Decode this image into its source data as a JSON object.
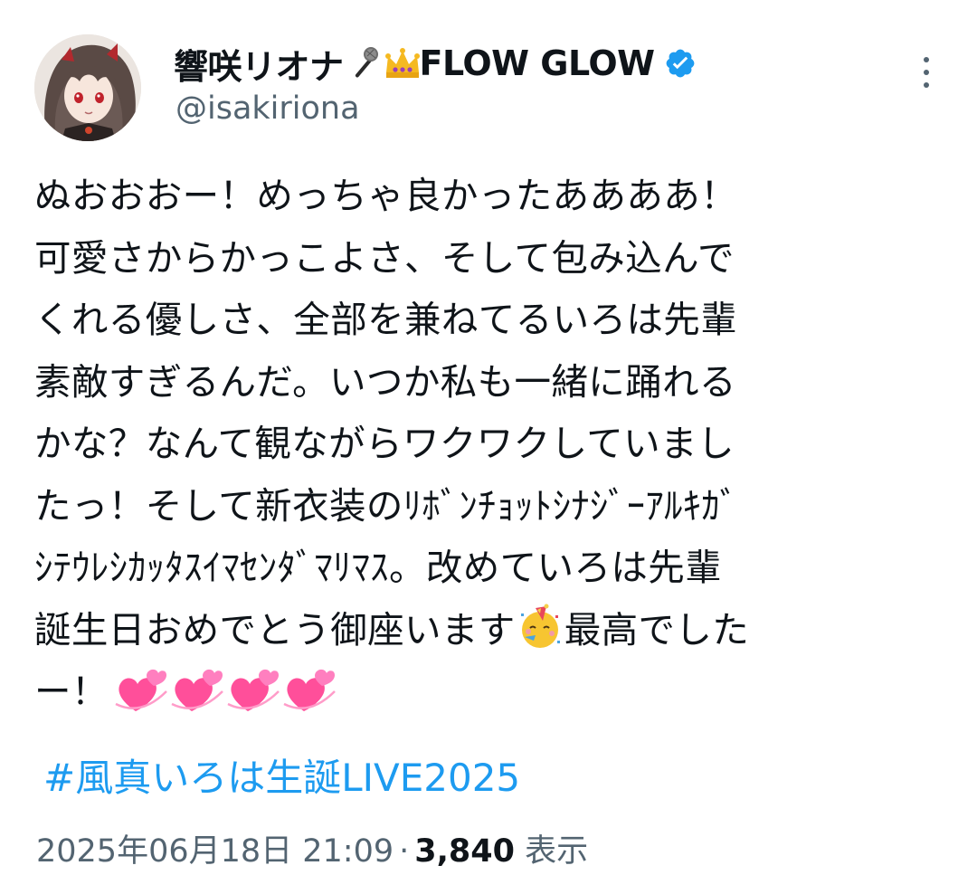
{
  "post": {
    "author": {
      "display_name": "響咲リオナ",
      "display_name_suffix": "FLOW GLOW",
      "name_emojis": [
        "microphone-emoji",
        "crown-emoji"
      ],
      "handle": "@isakiriona",
      "verified": true
    },
    "text_lines": [
      "ぬおおおー！めっちゃ良かったああああ！",
      "可愛さからかっこよさ、そして包み込んで",
      "くれる優しさ、全部を兼ねてるいろは先輩",
      "素敵すぎるんだ。いつか私も一緒に踊れる",
      "かな？なんて観ながらワクワクしていまし",
      "たっ！そして新衣装のﾘﾎﾞﾝﾁｮｯﾄｼﾅｼﾞｰｱﾙｷｶﾞ",
      "ｼﾃｳﾚｼｶｯﾀｽｲﾏｾﾝﾀﾞﾏﾘﾏｽ。改めていろは先輩"
    ],
    "text_line_8_before_emoji": "誕生日おめでとう御座います",
    "text_line_8_after_emoji": "最高でした",
    "text_line_9": "ー！",
    "hashtag": "#風真いろは生誕LIVE2025",
    "timestamp": "2025年06月18日 21:09",
    "separator": "·",
    "views_count": "3,840",
    "views_label": "表示",
    "colors": {
      "link": "#1d9bf0",
      "muted": "#536471",
      "text": "#0f1419",
      "verified": "#1d9bf0"
    },
    "icons": [
      "avatar",
      "verified-badge-icon",
      "more-options-icon",
      "partying-face-emoji",
      "two-hearts-emoji"
    ]
  }
}
